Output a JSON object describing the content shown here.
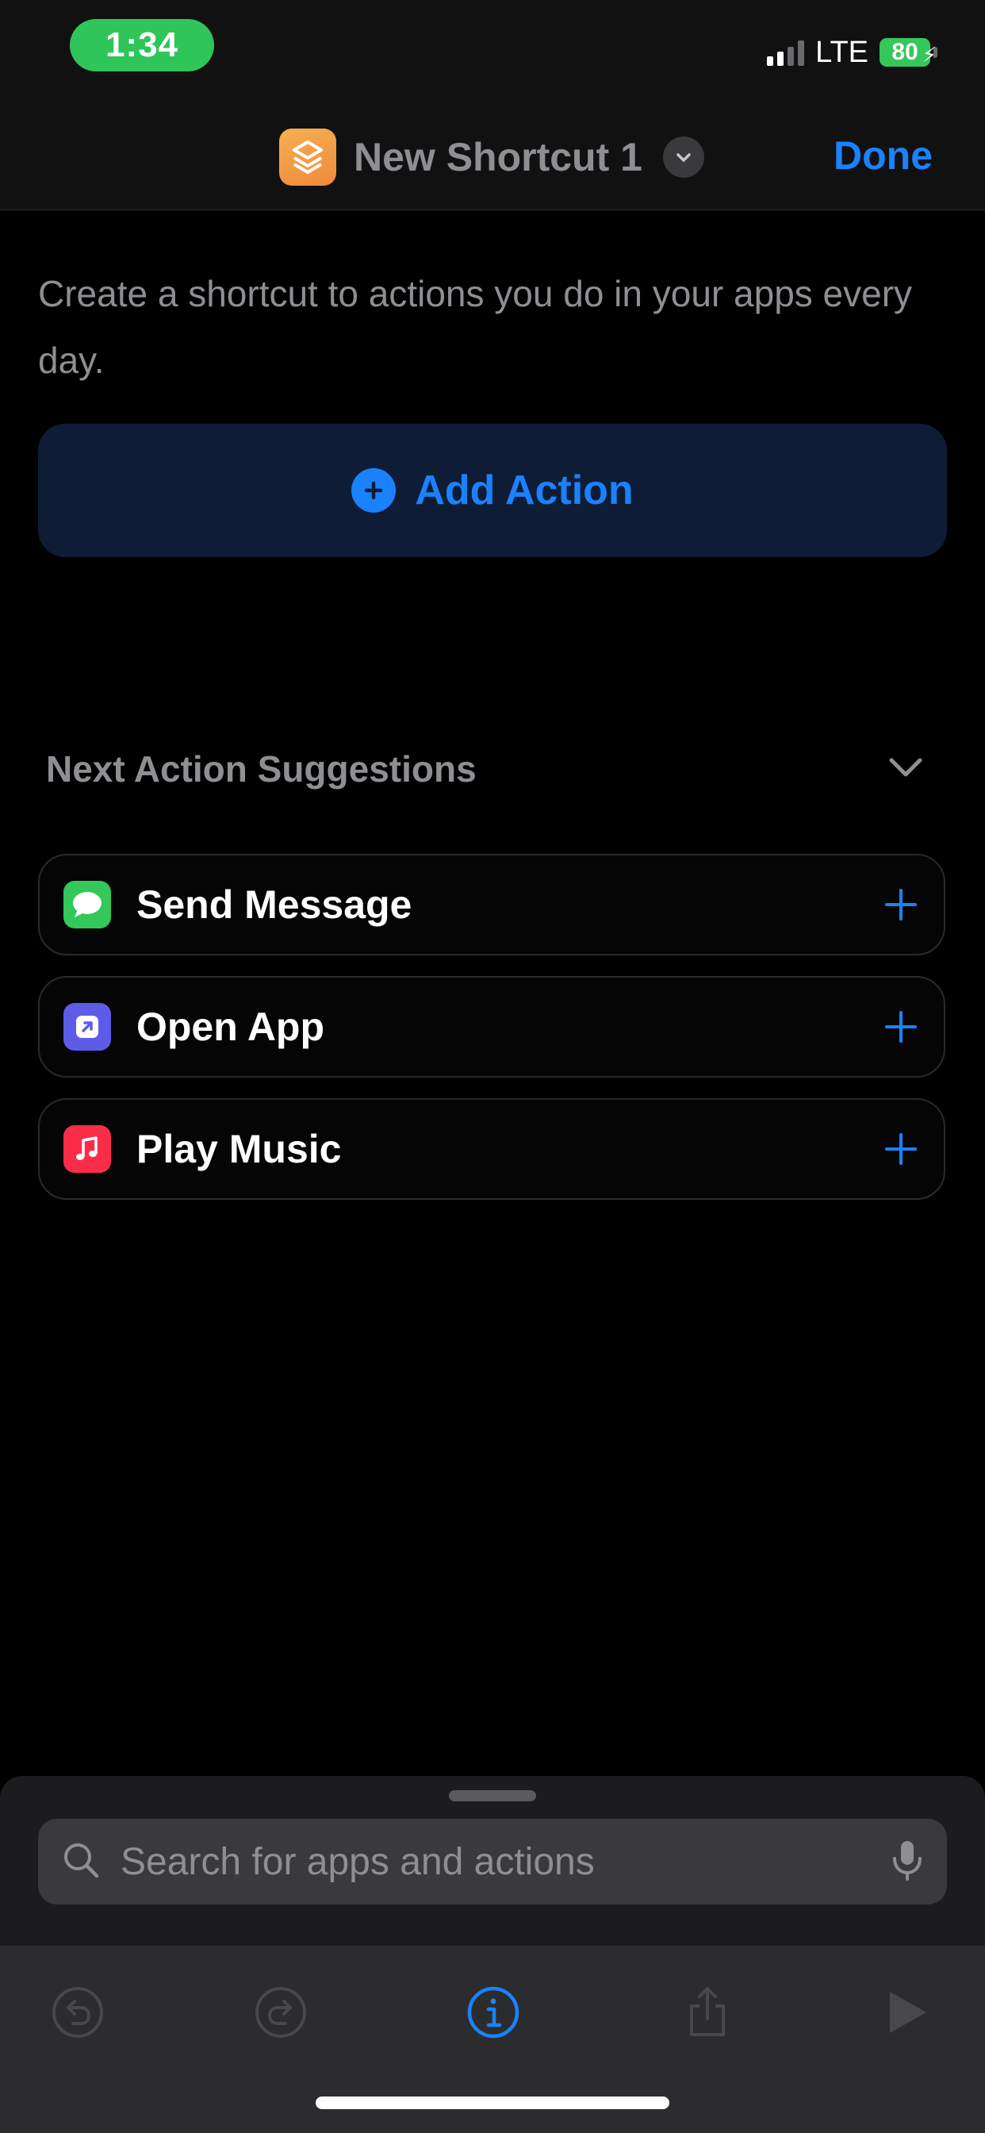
{
  "status_bar": {
    "time": "1:34",
    "network": "LTE",
    "battery": "80"
  },
  "header": {
    "title": "New Shortcut 1",
    "done_label": "Done",
    "app_icon": "shortcuts-icon"
  },
  "intro_text": "Create a shortcut to actions you do in your apps every day.",
  "add_action_label": "Add Action",
  "suggestions": {
    "title": "Next Action Suggestions",
    "items": [
      {
        "label": "Send Message",
        "icon": "messages-icon",
        "color": "#34c759"
      },
      {
        "label": "Open App",
        "icon": "open-app-icon",
        "color": "#5e5ce6"
      },
      {
        "label": "Play Music",
        "icon": "music-icon",
        "color": "#fa2d48"
      }
    ]
  },
  "search": {
    "placeholder": "Search for apps and actions"
  },
  "colors": {
    "accent": "#1a82ff",
    "time_pill": "#30c559"
  }
}
